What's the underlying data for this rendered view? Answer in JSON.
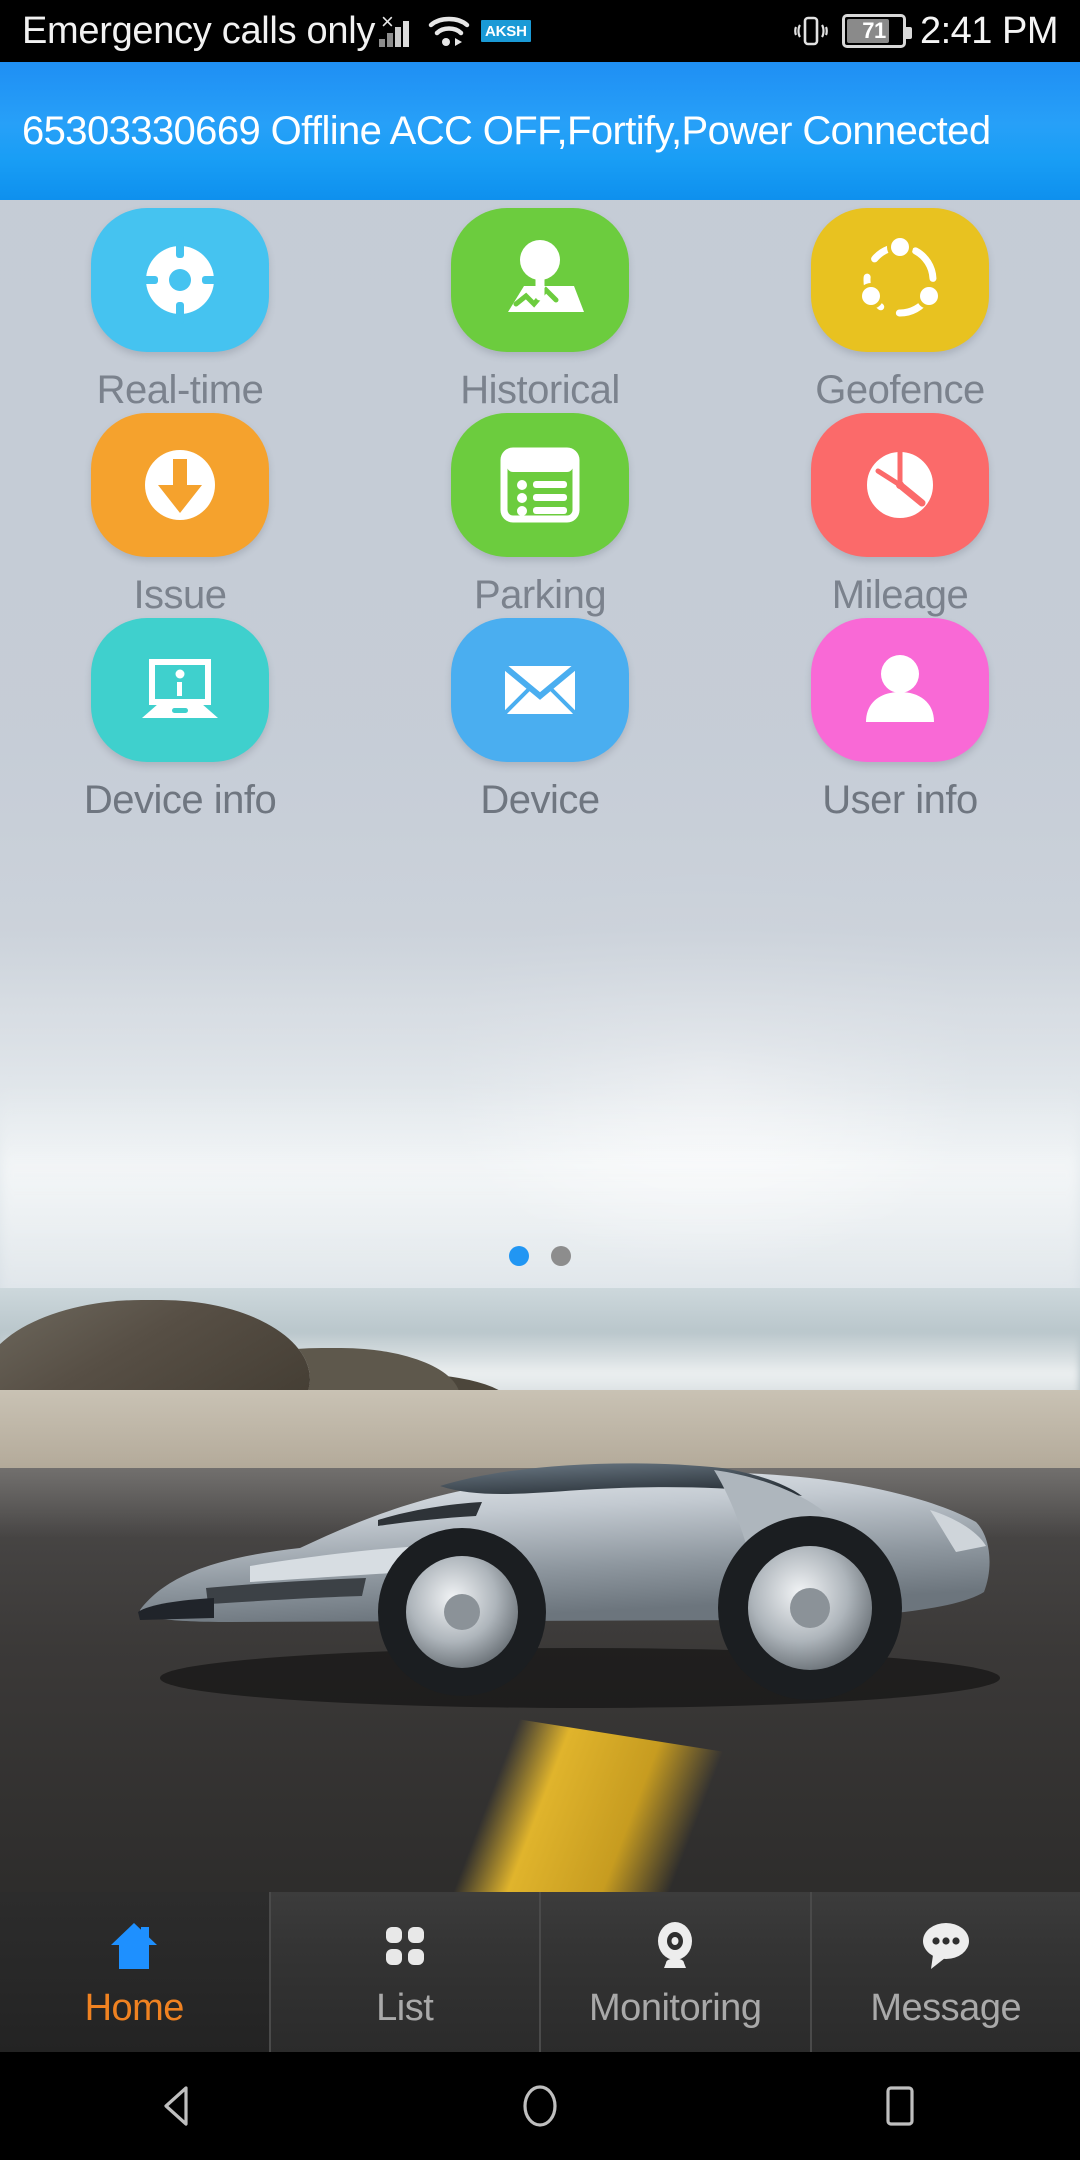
{
  "status_bar": {
    "carrier": "Emergency calls only",
    "signal_icon": "signal-bars-no-service-icon",
    "wifi_icon": "wifi-icon",
    "badge_label": "AKSH",
    "vibrate_icon": "vibrate-icon",
    "battery_level": "71",
    "clock": "2:41 PM"
  },
  "banner": {
    "text": "65303330669 Offline ACC OFF,Fortify,Power Connected",
    "color": "#1f8ff4"
  },
  "grid": {
    "rows": [
      [
        {
          "label": "Real-time",
          "icon": "target-crosshair-icon",
          "color": "#45c3f0"
        },
        {
          "label": "Historical",
          "icon": "map-pin-icon",
          "color": "#6ccc3e"
        },
        {
          "label": "Geofence",
          "icon": "geofence-share-icon",
          "color": "#e8c220"
        }
      ],
      [
        {
          "label": "Issue",
          "icon": "download-arrow-icon",
          "color": "#f5a22d"
        },
        {
          "label": "Parking",
          "icon": "list-form-icon",
          "color": "#6ccc3e"
        },
        {
          "label": "Mileage",
          "icon": "speedometer-icon",
          "color": "#fb6a6a"
        }
      ],
      [
        {
          "label": "Device info",
          "icon": "laptop-info-icon",
          "color": "#3fd0cd"
        },
        {
          "label": "Device",
          "icon": "envelope-icon",
          "color": "#4aaef0"
        },
        {
          "label": "User info",
          "icon": "person-icon",
          "color": "#f969d6"
        }
      ]
    ]
  },
  "pager": {
    "total_pages": 2,
    "active_page": 1,
    "active_color": "#2196f3",
    "inactive_color": "#8d8d8d"
  },
  "bottom_nav": {
    "active_label": "Home",
    "active_color": "#f08221",
    "items": [
      {
        "label": "Home",
        "icon": "home-icon",
        "active": true
      },
      {
        "label": "List",
        "icon": "grid-dots-icon",
        "active": false
      },
      {
        "label": "Monitoring",
        "icon": "camera-eye-icon",
        "active": false
      },
      {
        "label": "Message",
        "icon": "chat-bubble-icon",
        "active": false
      }
    ]
  },
  "android_nav": {
    "back_icon": "back-triangle-icon",
    "home_icon": "home-circle-icon",
    "recents_icon": "recents-square-icon"
  }
}
